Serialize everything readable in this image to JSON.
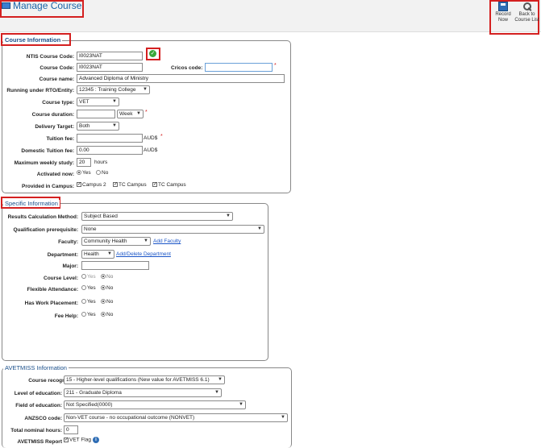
{
  "header": {
    "title": "Manage Course"
  },
  "toolbar": {
    "record_label_1": "Record",
    "record_label_2": "Now",
    "back_label_1": "Back to",
    "back_label_2": "Course List"
  },
  "course_info": {
    "legend": "Course Information",
    "ntis_label": "NTIS Course Code:",
    "ntis_value": "I0023NAT",
    "code_label": "Course Code:",
    "code_value": "I0023NAT",
    "cricos_label": "Cricos code:",
    "cricos_value": "",
    "name_label": "Course name:",
    "name_value": "Advanced Diploma of Ministry",
    "rto_label": "Running under RTO/Entity:",
    "rto_value": "12345 : Training College",
    "type_label": "Course type:",
    "type_value": "VET",
    "duration_label": "Course duration:",
    "duration_value": "",
    "duration_unit": "Week",
    "delivery_label": "Delivery Target:",
    "delivery_value": "Both",
    "tuition_label": "Tuition fee:",
    "tuition_value": "",
    "currency": "AUD$",
    "domestic_label": "Domestic Tuition fee:",
    "domestic_value": "0.00",
    "weekly_label": "Maximum weekly study:",
    "weekly_value": "20",
    "weekly_unit": "hours",
    "activated_label": "Activated now:",
    "yes": "Yes",
    "no": "No",
    "campus_label": "Provided in Campus:",
    "campus1": "Campus 2",
    "campus2": "TC Campus",
    "campus3": "TC Campus"
  },
  "specific_info": {
    "legend": "Specific Information",
    "results_label": "Results Calculation Method:",
    "results_value": "Subject Based",
    "prereq_label": "Qualification prerequisite:",
    "prereq_value": "None",
    "faculty_label": "Faculty:",
    "faculty_value": "Community Health",
    "add_faculty": "Add Faculty",
    "dept_label": "Department:",
    "dept_value": "Health",
    "add_dept": "Add/Delete Department",
    "major_label": "Major:",
    "major_value": "",
    "level_label": "Course Level:",
    "flex_label": "Flexible Attendance:",
    "work_label": "Has Work Placement:",
    "feehelp_label": "Fee Help:",
    "yes": "Yes",
    "no": "No"
  },
  "avetmiss": {
    "legend": "AVETMISS Information",
    "recog_label": "Course recognition:",
    "recog_value": "15 - Higher-level qualifications (New value for AVETMISS 6.1)",
    "edu_level_label": "Level of education:",
    "edu_level_value": "211 - Graduate Diploma",
    "field_label": "Field of education:",
    "field_value": "Not Specified(0000)",
    "anzsco_label": "ANZSCO code:",
    "anzsco_value": "Non-VET course - no occupational outcome (NONVET)",
    "hours_label": "Total nominal hours:",
    "hours_value": "0",
    "report_label": "AVETMISS Report",
    "vet_flag": "VET Flag"
  },
  "colors": {
    "accent": "#1a64a8",
    "highlight": "#d42020",
    "link": "#1a55c7"
  }
}
